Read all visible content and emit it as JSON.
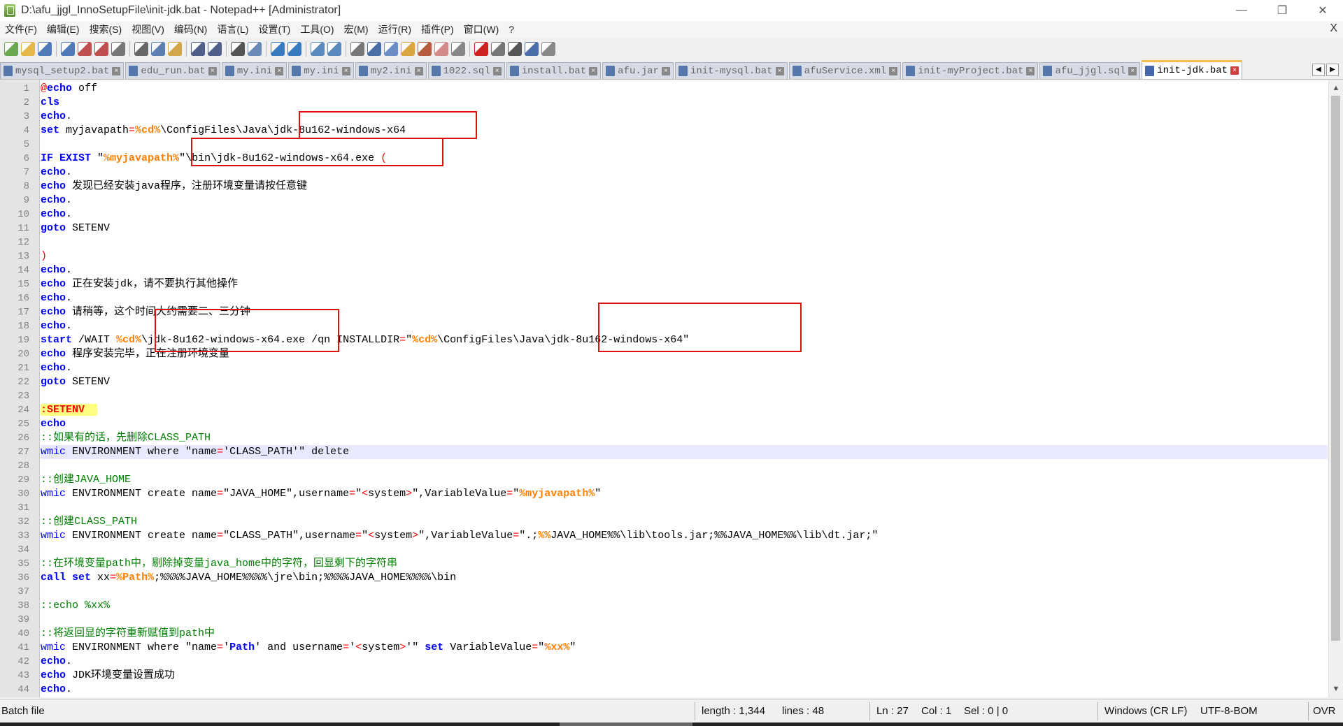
{
  "window": {
    "title": "D:\\afu_jjgl_InnoSetupFile\\init-jdk.bat - Notepad++ [Administrator]",
    "min_label": "—",
    "max_label": "❐",
    "close_label": "✕"
  },
  "menu": {
    "items": [
      "文件(F)",
      "编辑(E)",
      "搜索(S)",
      "视图(V)",
      "编码(N)",
      "语言(L)",
      "设置(T)",
      "工具(O)",
      "宏(M)",
      "运行(R)",
      "插件(P)",
      "窗口(W)",
      "?"
    ],
    "close_label": "X"
  },
  "toolbar": {
    "icons": [
      "new-file-icon",
      "open-file-icon",
      "save-icon",
      "save-all-icon",
      "close-icon",
      "close-all-icon",
      "print-icon",
      "cut-icon",
      "copy-icon",
      "paste-icon",
      "undo-icon",
      "redo-icon",
      "find-icon",
      "replace-icon",
      "zoom-in-icon",
      "zoom-out-icon",
      "sync-vertical-icon",
      "sync-horizontal-icon",
      "word-wrap-icon",
      "show-all-chars-icon",
      "indent-guide-icon",
      "doc-map-icon",
      "function-list-icon",
      "folder-workspace-icon",
      "monitor-icon",
      "record-macro-icon",
      "stop-record-icon",
      "play-macro-icon",
      "run-macro-multiple-icon",
      "save-macro-icon"
    ]
  },
  "tabs": [
    {
      "label": "mysql_setup2.bat",
      "active": false
    },
    {
      "label": "edu_run.bat",
      "active": false
    },
    {
      "label": "my.ini",
      "active": false
    },
    {
      "label": "my.ini",
      "active": false
    },
    {
      "label": "my2.ini",
      "active": false
    },
    {
      "label": "1022.sql",
      "active": false
    },
    {
      "label": "install.bat",
      "active": false
    },
    {
      "label": "afu.jar",
      "active": false
    },
    {
      "label": "init-mysql.bat",
      "active": false
    },
    {
      "label": "afuService.xml",
      "active": false
    },
    {
      "label": "init-myProject.bat",
      "active": false
    },
    {
      "label": "afu_jjgl.sql",
      "active": false
    },
    {
      "label": "init-jdk.bat",
      "active": true
    }
  ],
  "editor": {
    "current_line": 27,
    "lines": [
      [
        [
          "at",
          "@"
        ],
        [
          "kw",
          "echo"
        ],
        [
          "t",
          " off"
        ]
      ],
      [
        [
          "kw",
          "cls"
        ]
      ],
      [
        [
          "kw",
          "echo"
        ],
        [
          "t",
          "."
        ]
      ],
      [
        [
          "kw",
          "set"
        ],
        [
          "t",
          " myjavapath"
        ],
        [
          "op",
          "="
        ],
        [
          "var",
          "%cd%"
        ],
        [
          "t",
          "\\ConfigFiles\\Java\\jdk-8u162-windows-x64"
        ]
      ],
      [],
      [
        [
          "kw",
          "IF EXIST"
        ],
        [
          "t",
          " \""
        ],
        [
          "var",
          "%myjavapath%"
        ],
        [
          "t",
          "\"\\bin\\jdk-8u162-windows-x64.exe "
        ],
        [
          "op",
          "("
        ]
      ],
      [
        [
          "kw",
          "echo"
        ],
        [
          "t",
          "."
        ]
      ],
      [
        [
          "kw",
          "echo"
        ],
        [
          "t",
          " 发现已经安装java程序，注册环境变量请按任意键"
        ]
      ],
      [
        [
          "kw",
          "echo"
        ],
        [
          "t",
          "."
        ]
      ],
      [
        [
          "kw",
          "echo"
        ],
        [
          "t",
          "."
        ]
      ],
      [
        [
          "kw",
          "goto"
        ],
        [
          "t",
          " SETENV"
        ]
      ],
      [],
      [
        [
          "op",
          ")"
        ]
      ],
      [
        [
          "kw",
          "echo"
        ],
        [
          "t",
          "."
        ]
      ],
      [
        [
          "kw",
          "echo"
        ],
        [
          "t",
          " 正在安装jdk，请不要执行其他操作"
        ]
      ],
      [
        [
          "kw",
          "echo"
        ],
        [
          "t",
          "."
        ]
      ],
      [
        [
          "kw",
          "echo"
        ],
        [
          "t",
          " 请稍等，这个时间大约需要二、三分钟"
        ]
      ],
      [
        [
          "kw",
          "echo"
        ],
        [
          "t",
          "."
        ]
      ],
      [
        [
          "kw",
          "start"
        ],
        [
          "t",
          " /WAIT "
        ],
        [
          "var",
          "%cd%"
        ],
        [
          "t",
          "\\jdk-8u162-windows-x64.exe /qn INSTALLDIR"
        ],
        [
          "op",
          "="
        ],
        [
          "t",
          "\""
        ],
        [
          "var",
          "%cd%"
        ],
        [
          "t",
          "\\ConfigFiles\\Java\\jdk-8u162-windows-x64\""
        ]
      ],
      [
        [
          "kw",
          "echo"
        ],
        [
          "t",
          " 程序安装完毕，正在注册环境变量"
        ]
      ],
      [
        [
          "kw",
          "echo"
        ],
        [
          "t",
          "."
        ]
      ],
      [
        [
          "kw",
          "goto"
        ],
        [
          "t",
          " SETENV"
        ]
      ],
      [],
      [
        [
          "lbl",
          ":SETENV  "
        ]
      ],
      [
        [
          "kw",
          "echo"
        ]
      ],
      [
        [
          "cm",
          "::如果有的话，先删除CLASS_PATH"
        ]
      ],
      [
        [
          "cmd",
          "wmic"
        ],
        [
          "t",
          " ENVIRONMENT where \"name"
        ],
        [
          "op",
          "="
        ],
        [
          "t",
          "'CLASS_PATH'\" delete"
        ]
      ],
      [],
      [
        [
          "cm",
          "::创建JAVA_HOME"
        ]
      ],
      [
        [
          "cmd",
          "wmic"
        ],
        [
          "t",
          " ENVIRONMENT create name"
        ],
        [
          "op",
          "="
        ],
        [
          "t",
          "\"JAVA_HOME\",username"
        ],
        [
          "op",
          "="
        ],
        [
          "t",
          "\""
        ],
        [
          "op",
          "<"
        ],
        [
          "t",
          "system"
        ],
        [
          "op",
          ">"
        ],
        [
          "t",
          "\",VariableValue"
        ],
        [
          "op",
          "="
        ],
        [
          "t",
          "\""
        ],
        [
          "var",
          "%myjavapath%"
        ],
        [
          "t",
          "\""
        ]
      ],
      [],
      [
        [
          "cm",
          "::创建CLASS_PATH"
        ]
      ],
      [
        [
          "cmd",
          "wmic"
        ],
        [
          "t",
          " ENVIRONMENT create name"
        ],
        [
          "op",
          "="
        ],
        [
          "t",
          "\"CLASS_PATH\",username"
        ],
        [
          "op",
          "="
        ],
        [
          "t",
          "\""
        ],
        [
          "op",
          "<"
        ],
        [
          "t",
          "system"
        ],
        [
          "op",
          ">"
        ],
        [
          "t",
          "\",VariableValue"
        ],
        [
          "op",
          "="
        ],
        [
          "t",
          "\".;"
        ],
        [
          "var",
          "%%"
        ],
        [
          "t",
          "JAVA_HOME%%\\lib\\tools.jar;%%JAVA_HOME%%\\lib\\dt.jar;\""
        ]
      ],
      [],
      [
        [
          "cm",
          "::在环境变量path中，剔除掉变量java_home中的字符，回显剩下的字符串"
        ]
      ],
      [
        [
          "kw",
          "call"
        ],
        [
          "t",
          " "
        ],
        [
          "kw",
          "set"
        ],
        [
          "t",
          " xx"
        ],
        [
          "op",
          "="
        ],
        [
          "var",
          "%Path%"
        ],
        [
          "t",
          ";%%%%JAVA_HOME%%%%\\jre\\bin;%%%%JAVA_HOME%%%%\\bin"
        ]
      ],
      [],
      [
        [
          "cm",
          "::echo %xx%"
        ]
      ],
      [],
      [
        [
          "cm",
          "::将返回显的字符重新赋值到path中"
        ]
      ],
      [
        [
          "cmd",
          "wmic"
        ],
        [
          "t",
          " ENVIRONMENT where \"name"
        ],
        [
          "op",
          "="
        ],
        [
          "t",
          "'"
        ],
        [
          "kw",
          "Path"
        ],
        [
          "t",
          "' and username"
        ],
        [
          "op",
          "="
        ],
        [
          "t",
          "'"
        ],
        [
          "op",
          "<"
        ],
        [
          "t",
          "system"
        ],
        [
          "op",
          ">"
        ],
        [
          "t",
          "'\" "
        ],
        [
          "kw",
          "set"
        ],
        [
          "t",
          " VariableValue"
        ],
        [
          "op",
          "="
        ],
        [
          "t",
          "\""
        ],
        [
          "var",
          "%xx%"
        ],
        [
          "t",
          "\""
        ]
      ],
      [
        [
          "kw",
          "echo"
        ],
        [
          "t",
          "."
        ]
      ],
      [
        [
          "kw",
          "echo"
        ],
        [
          "t",
          " JDK环境变量设置成功"
        ]
      ],
      [
        [
          "kw",
          "echo"
        ],
        [
          "t",
          "."
        ]
      ],
      [
        [
          "kw",
          "echo"
        ],
        [
          "t",
          "."
        ]
      ]
    ]
  },
  "status": {
    "file_type": "Batch file",
    "length": "length : 1,344",
    "lines": "lines : 48",
    "ln": "Ln : 27",
    "col": "Col : 1",
    "sel": "Sel : 0 | 0",
    "eol": "Windows (CR LF)",
    "encoding": "UTF-8-BOM",
    "mode": "OVR"
  },
  "colors": {
    "keyword": "#0000ff",
    "variable": "#ff8000",
    "comment": "#008000",
    "operator": "#ff0000",
    "highlight_box": "#e01010",
    "active_tab_accent": "#fabd4d"
  }
}
